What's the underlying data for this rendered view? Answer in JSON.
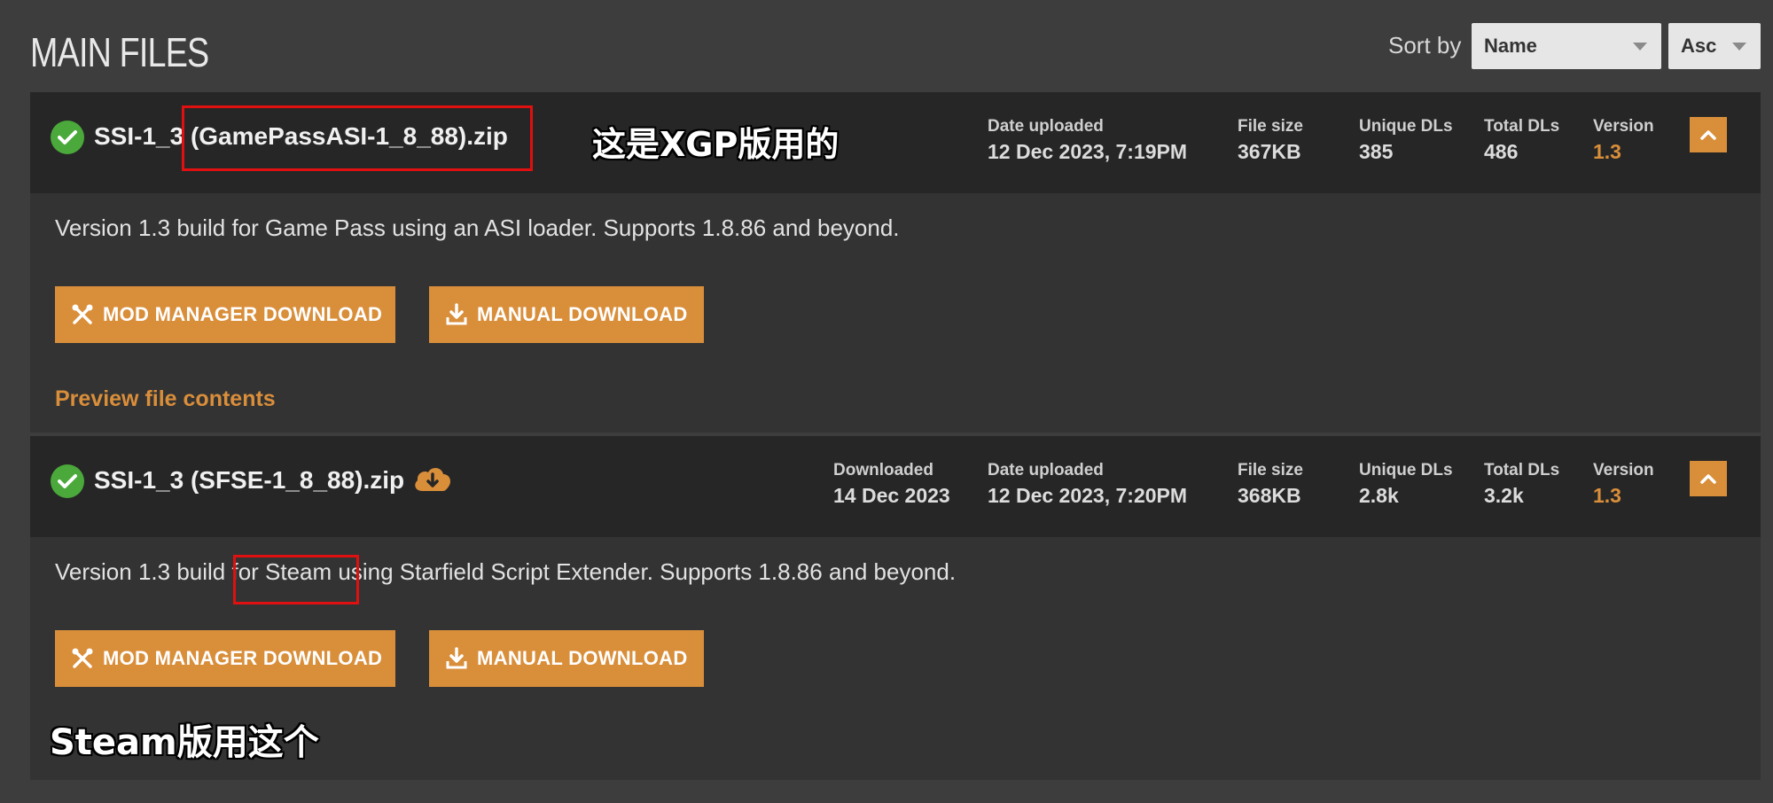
{
  "header": {
    "title": "MAIN FILES",
    "sort_label": "Sort by",
    "sort_field": "Name",
    "sort_order": "Asc"
  },
  "files": [
    {
      "name": "SSI-1_3 (GamePassASI-1_8_88).zip",
      "downloaded_label": "",
      "downloaded": "",
      "date_label": "Date uploaded",
      "date": "12 Dec 2023, 7:19PM",
      "size_label": "File size",
      "size": "367KB",
      "unique_label": "Unique DLs",
      "unique": "385",
      "total_label": "Total DLs",
      "total": "486",
      "version_label": "Version",
      "version": "1.3",
      "description": "Version 1.3 build for Game Pass using an ASI loader. Supports 1.8.86 and beyond.",
      "mod_manager_label": "MOD MANAGER DOWNLOAD",
      "manual_label": "MANUAL DOWNLOAD",
      "preview_label": "Preview file contents"
    },
    {
      "name": "SSI-1_3 (SFSE-1_8_88).zip",
      "downloaded_label": "Downloaded",
      "downloaded": "14 Dec 2023",
      "date_label": "Date uploaded",
      "date": "12 Dec 2023, 7:20PM",
      "size_label": "File size",
      "size": "368KB",
      "unique_label": "Unique DLs",
      "unique": "2.8k",
      "total_label": "Total DLs",
      "total": "3.2k",
      "version_label": "Version",
      "version": "1.3",
      "description": "Version 1.3 build for Steam using Starfield Script Extender. Supports 1.8.86 and beyond.",
      "mod_manager_label": "MOD MANAGER DOWNLOAD",
      "manual_label": "MANUAL DOWNLOAD"
    }
  ],
  "annotations": {
    "xgp_note": "这是XGP版用的",
    "steam_note": "Steam版用这个"
  },
  "colors": {
    "accent": "#d98e3a",
    "check": "#4aa93a",
    "highlight_box": "#e01010"
  }
}
